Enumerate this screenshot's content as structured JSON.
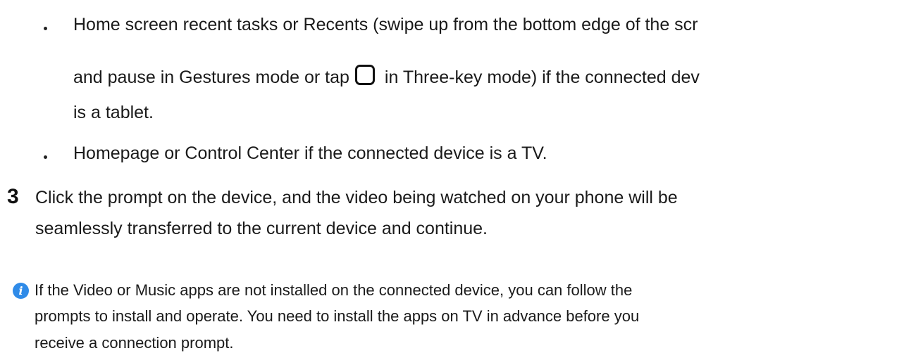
{
  "bullets": [
    {
      "line1": "Home screen recent tasks or Recents (swipe up from the bottom edge of the scr",
      "line2_before": "and pause in Gestures mode or tap",
      "line2_icon": "recents-square-icon",
      "line2_after": "in Three-key mode) if the connected dev",
      "line3": "is a tablet."
    },
    {
      "line1": "Homepage or Control Center if the connected device is a TV."
    }
  ],
  "step": {
    "number": "3",
    "line1": "Click the prompt on the device, and the video being watched on your phone will be",
    "line2": "seamlessly transferred to the current device and continue."
  },
  "note": {
    "icon": "info-icon",
    "icon_color": "#2f8be8",
    "lines": [
      "If the Video or Music apps are not installed on the connected device, you can follow the",
      "prompts to install and operate. You need to install the apps on TV in advance before you",
      "receive a connection prompt."
    ]
  }
}
